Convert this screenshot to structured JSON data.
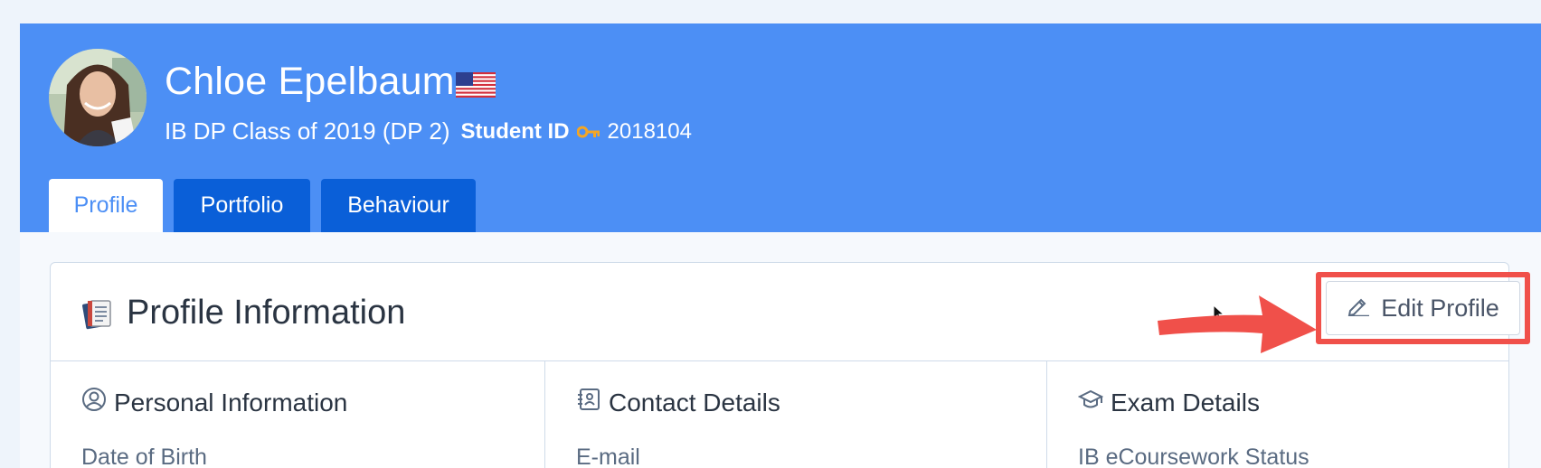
{
  "student": {
    "name": "Chloe Epelbaum",
    "flag_icon": "us-flag-icon",
    "class_text": "IB DP Class of 2019 (DP 2)",
    "student_id_label": "Student ID",
    "student_id_value": "2018104"
  },
  "tabs": [
    {
      "label": "Profile",
      "active": true
    },
    {
      "label": "Portfolio",
      "active": false
    },
    {
      "label": "Behaviour",
      "active": false
    }
  ],
  "profile_card": {
    "title": "Profile Information",
    "title_icon": "notebook-icon",
    "edit_button": "Edit Profile",
    "edit_icon": "pencil-icon"
  },
  "sections": [
    {
      "title": "Personal Information",
      "icon": "user-circle-icon",
      "first_field": "Date of Birth"
    },
    {
      "title": "Contact Details",
      "icon": "address-book-icon",
      "first_field": "E-mail"
    },
    {
      "title": "Exam Details",
      "icon": "graduation-cap-icon",
      "first_field": "IB eCoursework Status"
    }
  ],
  "colors": {
    "header_blue": "#4c8ff5",
    "tab_dark_blue": "#0a5fd8",
    "annotation_red": "#f0504a",
    "key_orange": "#f5a623"
  }
}
